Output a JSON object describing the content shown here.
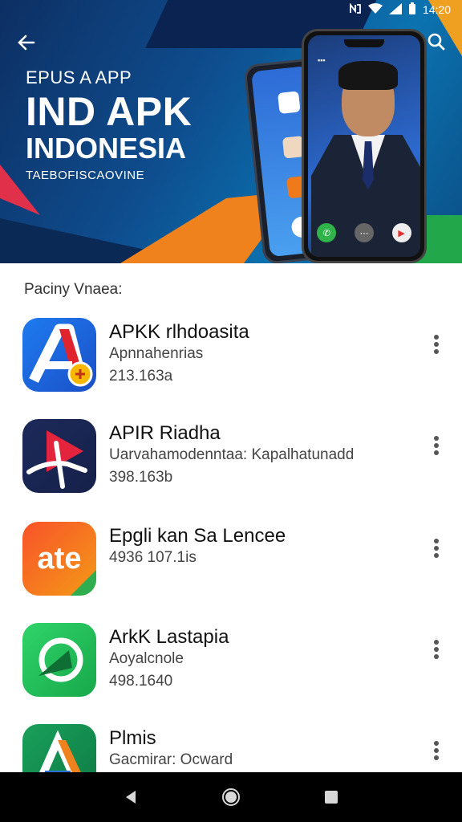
{
  "status_bar": {
    "time": "14:20",
    "icons": [
      "nfc-icon",
      "wifi-icon",
      "signal-icon",
      "battery-icon"
    ]
  },
  "hero": {
    "kicker": "EPUS A APP",
    "title": "IND APK",
    "subtitle": "INDONESIA",
    "tagline": "TAEBOFISCAOVINE",
    "colors": {
      "navy": "#0d2f63",
      "blue": "#0b73b0",
      "orange": "#f0821e",
      "green": "#22a84a",
      "red": "#e0304a"
    }
  },
  "section": {
    "title": "Paciny Vnaea:"
  },
  "apps": [
    {
      "name": "APKK rlhdoasita",
      "line2": "Apnnahenrias",
      "line3": "213.163a",
      "icon": "red-a-logo-icon"
    },
    {
      "name": "APIR Riadha",
      "line2": "Uarvahamodenntaa: Kapalhatunadd",
      "line3": "398.163b",
      "icon": "red-arrow-logo-icon"
    },
    {
      "name": "Epgli kan Sa Lencee",
      "line2": "4936 107.1is",
      "line3": "",
      "icon": "ate-logo-icon"
    },
    {
      "name": "ArkK Lastapia",
      "line2": "Aoyalcnole",
      "line3": "498.1640",
      "icon": "green-swoosh-logo-icon"
    },
    {
      "name": "Plmis",
      "line2": "Gacmirar: Ocward",
      "line3": "",
      "icon": "a-triangle-logo-icon"
    }
  ],
  "nav": {
    "items": [
      "back-icon",
      "home-icon",
      "recents-icon"
    ]
  }
}
